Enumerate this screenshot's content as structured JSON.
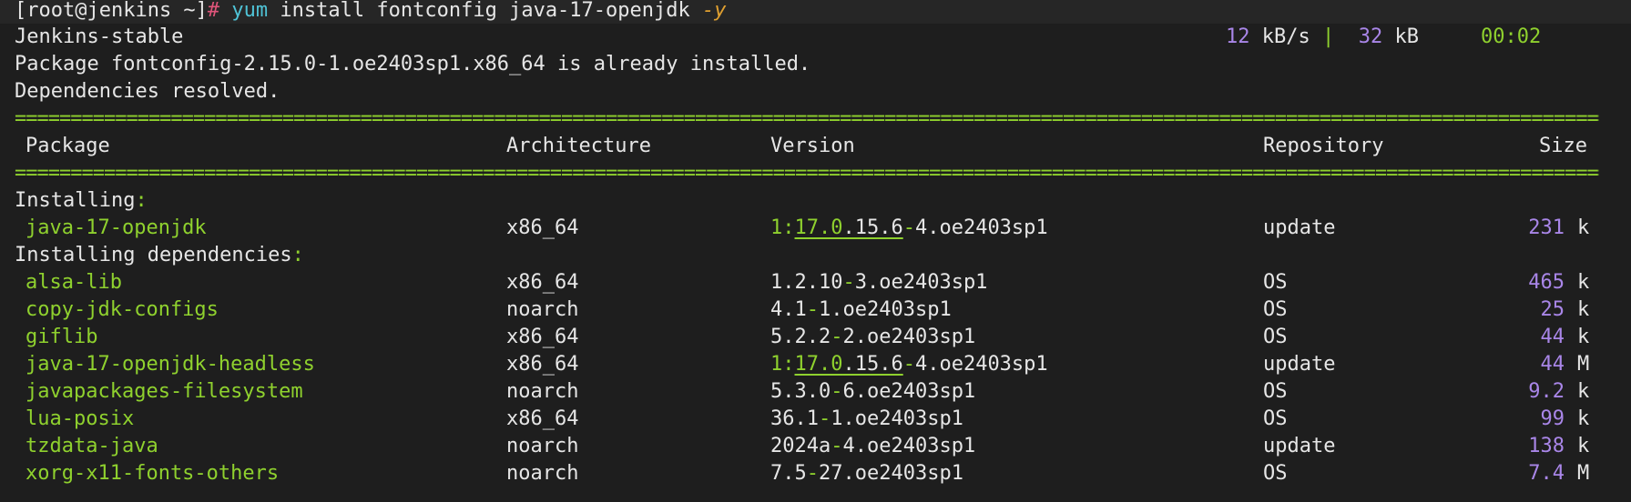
{
  "prompt": {
    "user_host": "[root@jenkins ~]",
    "symbol": "#",
    "cmd": "yum",
    "args": "install fontconfig java-17-openjdk",
    "flag": "-y"
  },
  "repo_line": {
    "name": "Jenkins-stable",
    "speed": "12",
    "speed_unit": "kB/s",
    "sep": "|",
    "size": "32",
    "size_unit": "kB",
    "time": "00:02"
  },
  "messages": {
    "installed": "Package fontconfig-2.15.0-1.oe2403sp1.x86_64 is already installed.",
    "resolved": "Dependencies resolved."
  },
  "rule": "================================================================================================================================================",
  "table": {
    "headers": {
      "package": "Package",
      "arch": "Architecture",
      "version": "Version",
      "repo": "Repository",
      "size": "Size"
    },
    "section_installing": "Installing",
    "section_deps": "Installing dependencies",
    "installing": [
      {
        "pkg": "java-17-openjdk",
        "arch": "x86_64",
        "version": "1:17.0.15.6-4.oe2403sp1",
        "repo": "update",
        "size": "231",
        "unit": "k"
      }
    ],
    "deps": [
      {
        "pkg": "alsa-lib",
        "arch": "x86_64",
        "version": "1.2.10-3.oe2403sp1",
        "repo": "OS",
        "size": "465",
        "unit": "k"
      },
      {
        "pkg": "copy-jdk-configs",
        "arch": "noarch",
        "version": "4.1-1.oe2403sp1",
        "repo": "OS",
        "size": "25",
        "unit": "k"
      },
      {
        "pkg": "giflib",
        "arch": "x86_64",
        "version": "5.2.2-2.oe2403sp1",
        "repo": "OS",
        "size": "44",
        "unit": "k"
      },
      {
        "pkg": "java-17-openjdk-headless",
        "arch": "x86_64",
        "version": "1:17.0.15.6-4.oe2403sp1",
        "repo": "update",
        "size": "44",
        "unit": "M"
      },
      {
        "pkg": "javapackages-filesystem",
        "arch": "noarch",
        "version": "5.3.0-6.oe2403sp1",
        "repo": "OS",
        "size": "9.2",
        "unit": "k"
      },
      {
        "pkg": "lua-posix",
        "arch": "x86_64",
        "version": "36.1-1.oe2403sp1",
        "repo": "OS",
        "size": "99",
        "unit": "k"
      },
      {
        "pkg": "tzdata-java",
        "arch": "noarch",
        "version": "2024a-4.oe2403sp1",
        "repo": "update",
        "size": "138",
        "unit": "k"
      },
      {
        "pkg": "xorg-x11-fonts-others",
        "arch": "noarch",
        "version": "7.5-27.oe2403sp1",
        "repo": "OS",
        "size": "7.4",
        "unit": "M"
      }
    ]
  }
}
